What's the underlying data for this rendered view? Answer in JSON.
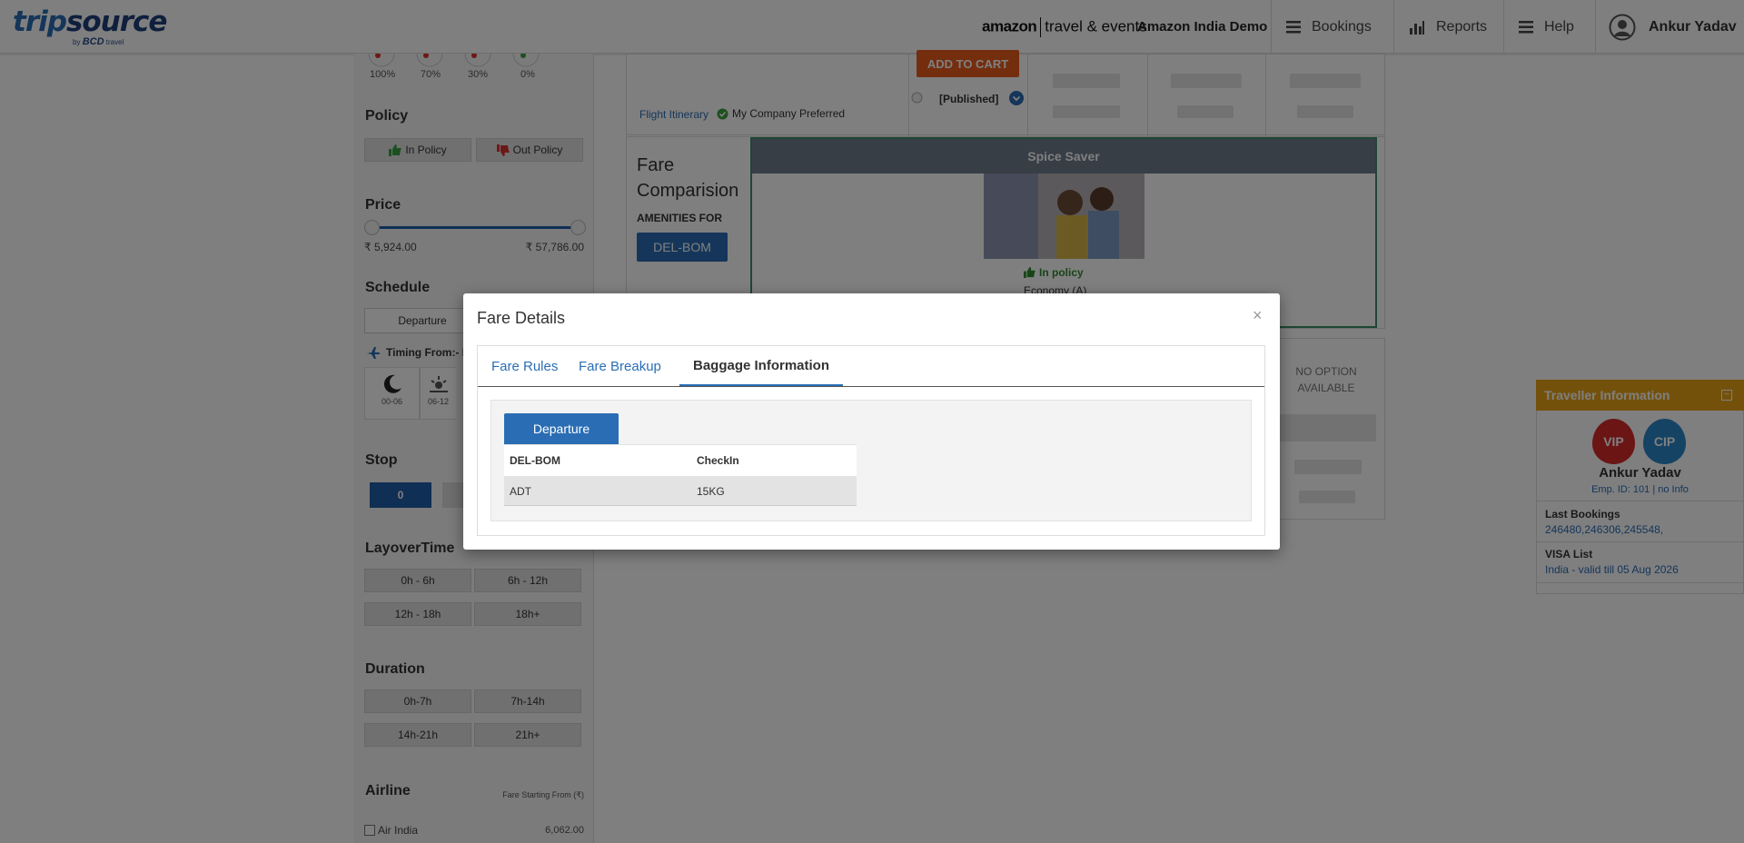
{
  "header": {
    "logo_main": "trip",
    "logo_main2": "source",
    "logo_sub": "by",
    "logo_sub_brand": "BCD",
    "logo_sub_tail": "travel",
    "brand_amazon": "amazon",
    "brand_tail": "travel & events",
    "company": "Amazon India Demo",
    "nav": [
      {
        "label": "Bookings",
        "icon": "menu-icon"
      },
      {
        "label": "Reports",
        "icon": "bar-chart-icon"
      },
      {
        "label": "Help",
        "icon": "menu-icon"
      }
    ],
    "user_name": "Ankur Yadav"
  },
  "sidebar": {
    "percents": [
      "100%",
      "70%",
      "30%",
      "0%"
    ],
    "policy_title": "Policy",
    "in_policy": "In Policy",
    "out_policy": "Out Policy",
    "price_title": "Price",
    "price_min": "₹ 5,924.00",
    "price_max": "₹ 57,786.00",
    "schedule_title": "Schedule",
    "departure": "Departure",
    "timing": "Timing From:- D",
    "time_slots": [
      "00-06",
      "06-12"
    ],
    "stop_title": "Stop",
    "stop_value": "0",
    "layover_title": "LayoverTime",
    "layover": [
      "0h - 6h",
      "6h - 12h",
      "12h - 18h",
      "18h+"
    ],
    "duration_title": "Duration",
    "duration": [
      "0h-7h",
      "7h-14h",
      "14h-21h",
      "21h+"
    ],
    "airline_title": "Airline",
    "fare_from": "Fare Starting From (₹)",
    "airline_name": "Air India",
    "airline_price": "6,062.00"
  },
  "main": {
    "add_to_cart": "ADD TO CART",
    "flight_itinerary": "Flight Itinerary",
    "preferred": "My Company Preferred",
    "published": "[Published]",
    "fare_title": "Fare Comparision",
    "amenities": "AMENITIES FOR",
    "route": "DEL-BOM",
    "fare_name": "Spice Saver",
    "in_policy": "In policy",
    "cabin": "Economy (A)",
    "no_option": "NO OPTION AVAILABLE"
  },
  "traveller": {
    "title": "Traveller Information",
    "badge_vip": "VIP",
    "badge_cip": "CIP",
    "name": "Ankur Yadav",
    "emp": "Emp. ID: 101 | no Info",
    "last_bookings_label": "Last Bookings",
    "last_bookings": "246480,246306,245548,",
    "visa_label": "VISA List",
    "visa": "India - valid till 05 Aug 2026"
  },
  "modal": {
    "title": "Fare Details",
    "close": "×",
    "tabs": [
      "Fare Rules",
      "Fare Breakup",
      "Baggage Information"
    ],
    "active_tab": "Baggage Information",
    "sub_tab": "Departure",
    "table_headers": [
      "DEL-BOM",
      "CheckIn"
    ],
    "rows": [
      [
        "ADT",
        "15KG"
      ]
    ]
  },
  "colors": {
    "accent": "#2a6db5",
    "cart": "#e85d1c",
    "traveller_header": "#e8a317",
    "vip": "#d62b2b",
    "cip": "#2a86c9"
  }
}
